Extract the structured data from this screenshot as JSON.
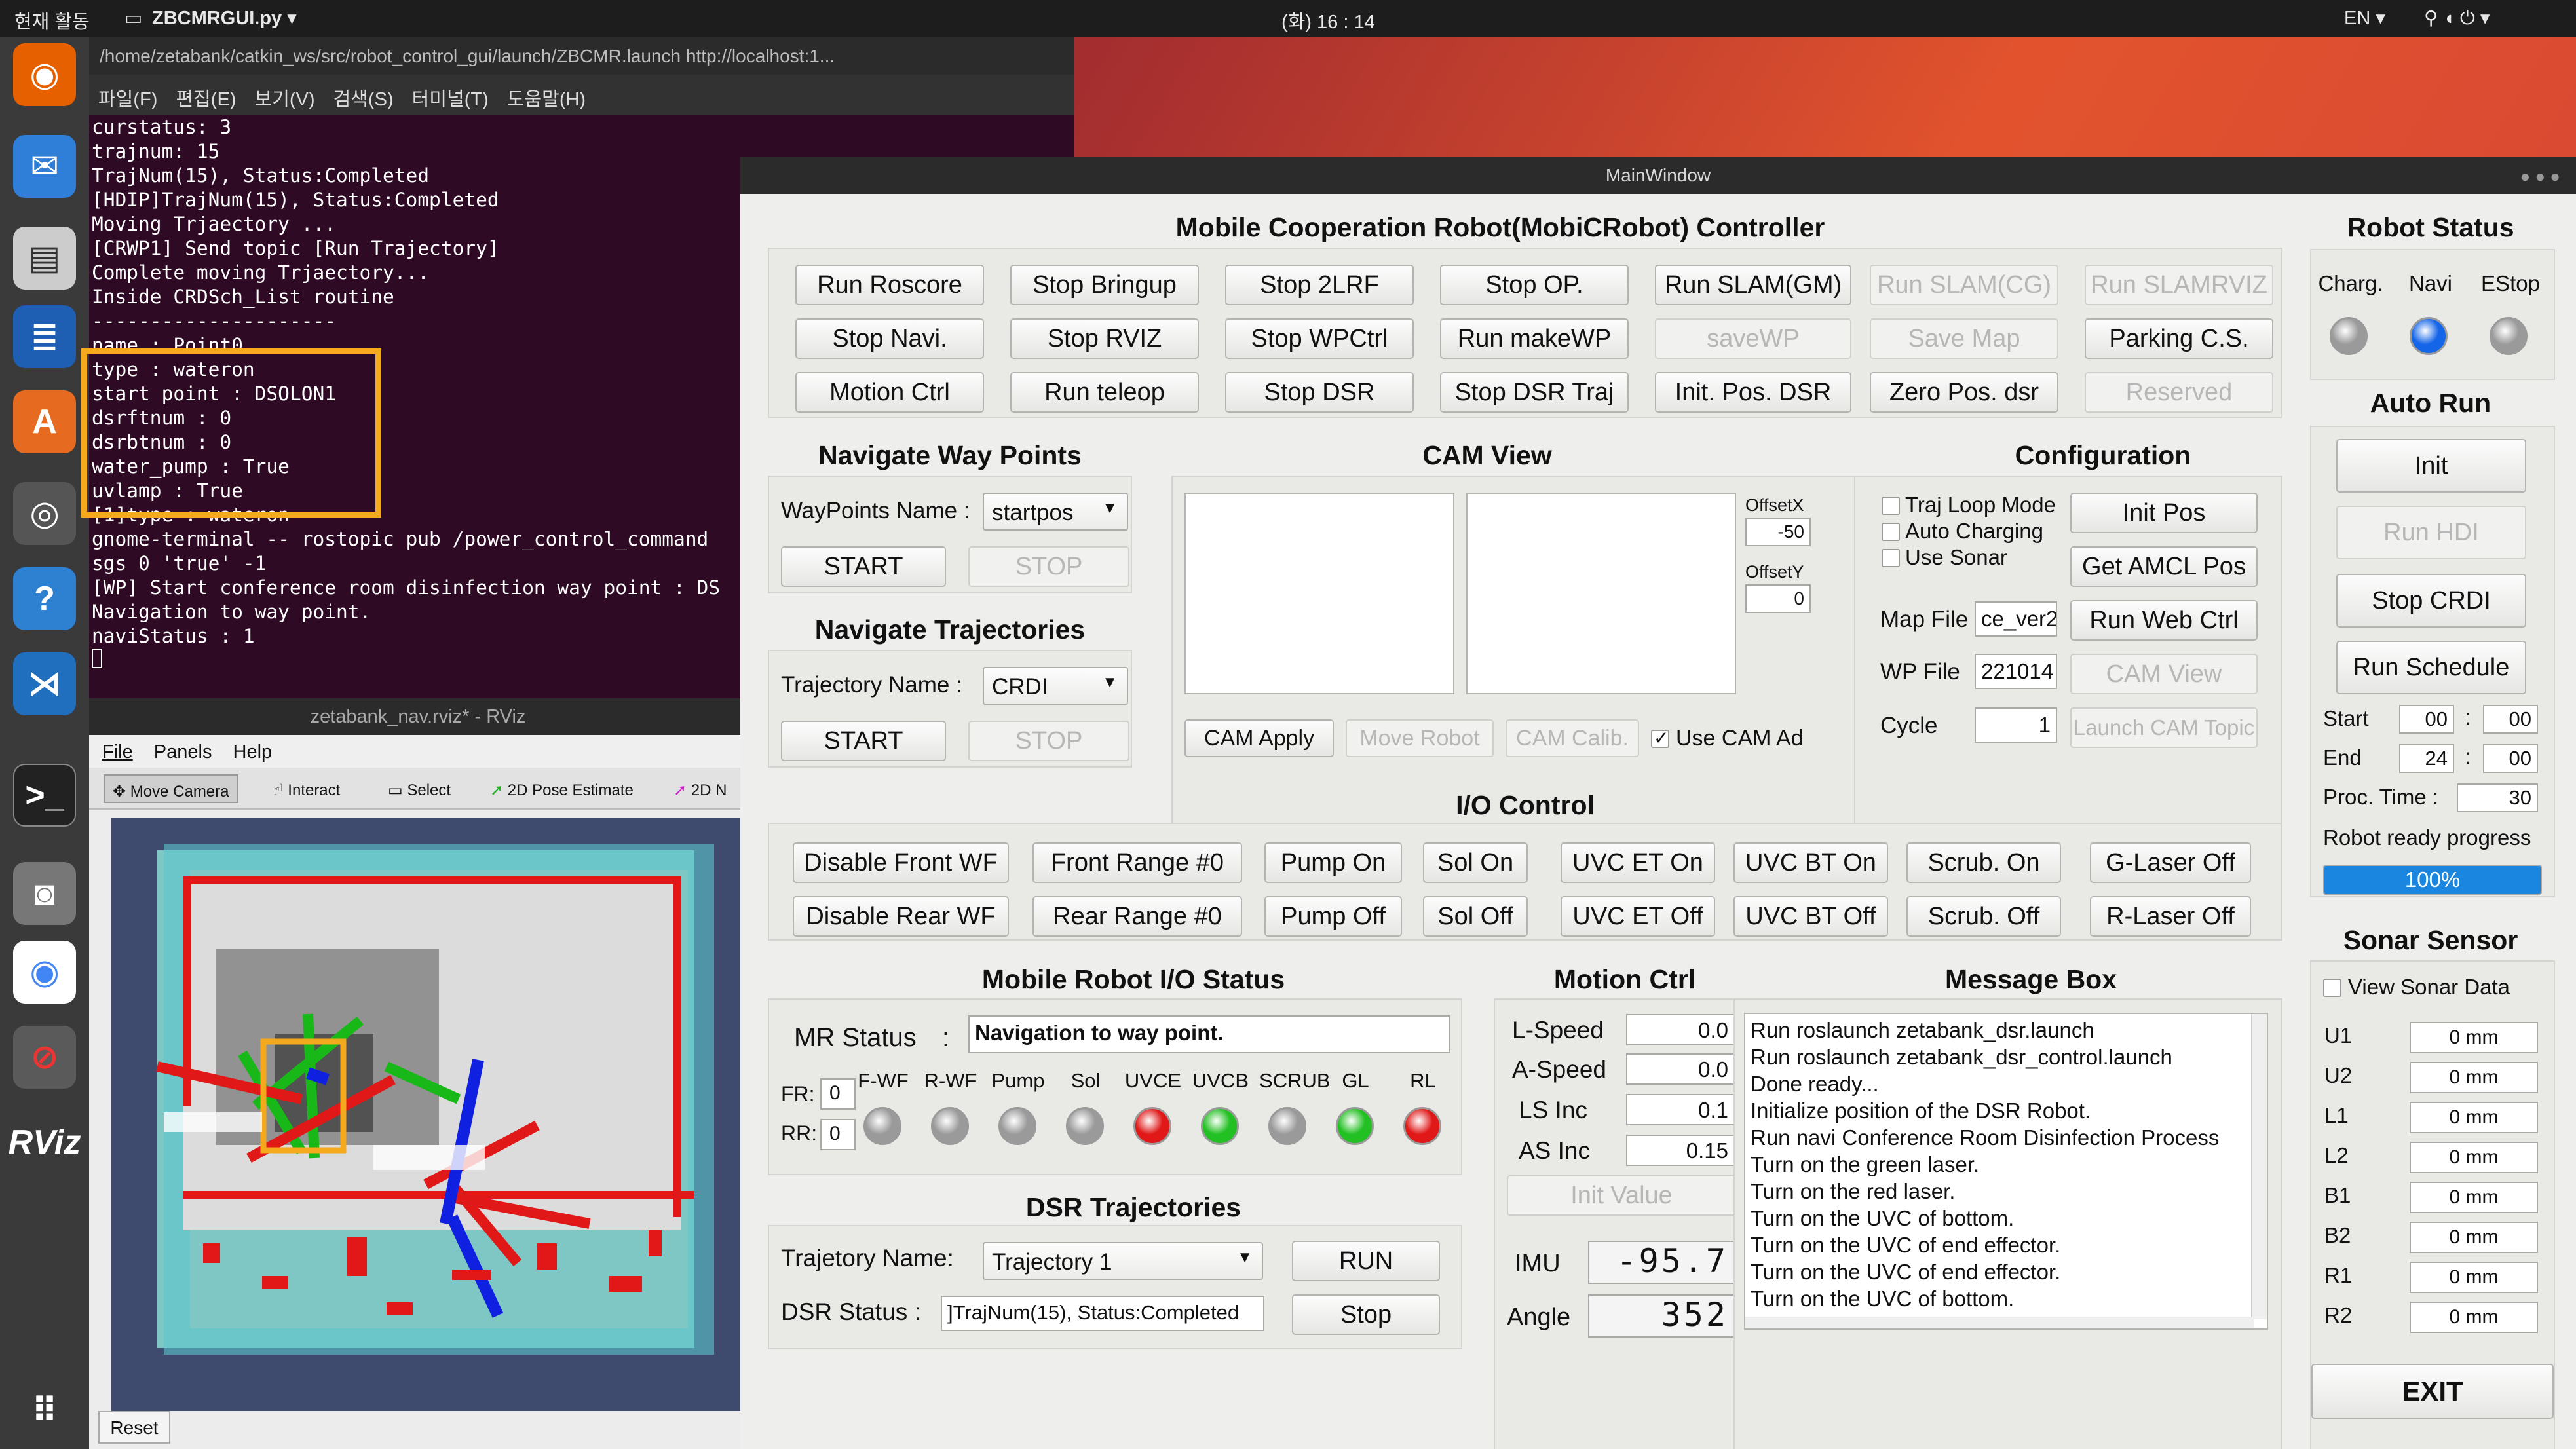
{
  "topbar": {
    "activities": "현재 활동",
    "app_name": "ZBCMRGUI.py ▾",
    "clock": "(화) 16 : 14",
    "lang": "EN ▾",
    "status_icons": "⚲ ◖ ⏻ ▾"
  },
  "terminal": {
    "title": "/home/zetabank/catkin_ws/src/robot_control_gui/launch/ZBCMR.launch http://localhost:1...",
    "menu": "파일(F) 편집(E) 보기(V) 검색(S) 터미널(T) 도움말(H)",
    "lines": [
      "curstatus: 3",
      "trajnum: 15",
      "TrajNum(15), Status:Completed",
      "[HDIP]TrajNum(15), Status:Completed",
      "Moving Trjaectory ...",
      "[CRWP1] Send topic [Run Trajectory]",
      "Complete moving Trjaectory...",
      "Inside CRDSch_List routine",
      "---------------------",
      "name : Point0",
      "type : wateron",
      "start point : DSOLON1",
      "dsrftnum : 0",
      "dsrbtnum : 0",
      "water_pump : True",
      "uvlamp : True",
      "",
      "[1]type : wateron",
      "gnome-terminal -- rostopic pub /power_control_command",
      "sgs 0 'true' -1",
      "[WP] Start conference room disinfection way point : DS",
      "Navigation to way point.",
      "naviStatus : 1"
    ]
  },
  "rviz": {
    "title": "zetabank_nav.rviz* - RViz",
    "menu": [
      "File",
      "Panels",
      "Help"
    ],
    "tools": [
      "Move Camera",
      "Interact",
      "Select",
      "2D Pose Estimate",
      "2D N"
    ],
    "reset": "Reset"
  },
  "main": {
    "window_title": "MainWindow",
    "controller_title": "Mobile Cooperation Robot(MobiCRobot) Controller",
    "top_buttons": [
      [
        "Run Roscore",
        "Stop Bringup",
        "Stop 2LRF",
        "Stop OP.",
        "Run SLAM(GM)",
        "Run SLAM(CG)",
        "Run SLAMRVIZ"
      ],
      [
        "Stop Navi.",
        "Stop RVIZ",
        "Stop WPCtrl",
        "Run makeWP",
        "saveWP",
        "Save Map",
        "Parking C.S."
      ],
      [
        "Motion Ctrl",
        "Run teleop",
        "Stop DSR",
        "Stop DSR Traj",
        "Init. Pos. DSR",
        "Zero Pos. dsr",
        "Reserved"
      ]
    ],
    "nav_wp": {
      "title": "Navigate Way Points",
      "name_label": "WayPoints Name :",
      "name_value": "startpos",
      "start": "START",
      "stop": "STOP"
    },
    "nav_traj": {
      "title": "Navigate Trajectories",
      "name_label": "Trajectory Name :",
      "name_value": "CRDI",
      "start": "START",
      "stop": "STOP"
    },
    "cam": {
      "title": "CAM View",
      "offsetx_label": "OffsetX",
      "offsetx": "-50",
      "offsety_label": "OffsetY",
      "offsety": "0",
      "apply": "CAM Apply",
      "move_robot": "Move Robot",
      "calib": "CAM Calib.",
      "use_ad": "Use CAM Ad"
    },
    "config": {
      "title": "Configuration",
      "traj_loop": "Traj Loop Mode",
      "auto_charging": "Auto Charging",
      "use_sonar": "Use Sonar",
      "init_pos": "Init Pos",
      "get_amcl": "Get AMCL Pos",
      "run_web": "Run Web Ctrl",
      "cam_view": "CAM View",
      "launch_cam": "Launch CAM Topic",
      "map_file_label": "Map File",
      "map_file": "ce_ver2",
      "wp_file_label": "WP File",
      "wp_file": "221014",
      "cycle_label": "Cycle",
      "cycle": "1"
    },
    "io": {
      "title": "I/O Control",
      "row1": [
        "Disable Front WF",
        "Front Range #0",
        "Pump On",
        "Sol On",
        "UVC ET On",
        "UVC BT On",
        "Scrub. On",
        "G-Laser Off"
      ],
      "row2": [
        "Disable Rear WF",
        "Rear Range #0",
        "Pump Off",
        "Sol Off",
        "UVC ET Off",
        "UVC BT Off",
        "Scrub. Off",
        "R-Laser Off"
      ]
    },
    "io_status": {
      "title": "Mobile Robot I/O Status",
      "mr_label": "MR Status",
      "mr_colon": ":",
      "mr_value": "Navigation to way point.",
      "fr_label": "FR:",
      "fr_value": "0",
      "rr_label": "RR:",
      "rr_value": "0",
      "leds": [
        {
          "label": "F-WF",
          "color": "#9a9a9a"
        },
        {
          "label": "R-WF",
          "color": "#9a9a9a"
        },
        {
          "label": "Pump",
          "color": "#9a9a9a"
        },
        {
          "label": "Sol",
          "color": "#9a9a9a"
        },
        {
          "label": "UVCE",
          "color": "#e01818"
        },
        {
          "label": "UVCB",
          "color": "#22c022"
        },
        {
          "label": "SCRUB",
          "color": "#9a9a9a"
        },
        {
          "label": "GL",
          "color": "#22c022"
        },
        {
          "label": "RL",
          "color": "#e01818"
        }
      ]
    },
    "dsr": {
      "title": "DSR Trajectories",
      "name_label": "Trajetory Name:",
      "name_value": "Trajectory 1",
      "run": "RUN",
      "status_label": "DSR Status :",
      "status_value": "]TrajNum(15), Status:Completed",
      "stop": "Stop"
    },
    "motion": {
      "title": "Motion Ctrl",
      "lspeed_label": "L-Speed",
      "lspeed": "0.0",
      "aspeed_label": "A-Speed",
      "aspeed": "0.0",
      "lsinc_label": "LS Inc",
      "lsinc": "0.1",
      "asinc_label": "AS Inc",
      "asinc": "0.15",
      "init_value": "Init Value",
      "imu_label": "IMU",
      "imu": "-95.7",
      "angle_label": "Angle",
      "angle": "352"
    },
    "msgbox": {
      "title": "Message Box",
      "lines": [
        "Run roslaunch zetabank_dsr.launch",
        "Run roslaunch zetabank_dsr_control.launch",
        "Done ready...",
        "Initialize position of the DSR Robot.",
        "Run navi Conference Room Disinfection Process",
        "Turn on the green laser.",
        "Turn on the red laser.",
        "Turn on the UVC of bottom.",
        "Turn on the UVC of end effector.",
        "Turn on the UVC of end effector.",
        "Turn on the UVC of bottom."
      ]
    },
    "robot_status": {
      "title": "Robot Status",
      "leds": [
        {
          "label": "Charg.",
          "color": "#9a9a9a"
        },
        {
          "label": "Navi",
          "color": "#1565e8"
        },
        {
          "label": "EStop",
          "color": "#9a9a9a"
        }
      ]
    },
    "auto_run": {
      "title": "Auto Run",
      "init": "Init",
      "run_hdi": "Run HDI",
      "stop_crdi": "Stop CRDI",
      "run_schedule": "Run Schedule",
      "start_label": "Start",
      "start_h": "00",
      "start_m": "00",
      "end_label": "End",
      "end_h": "24",
      "end_m": "00",
      "colon": ":",
      "proc_label": "Proc. Time :",
      "proc": "30",
      "ready_label": "Robot ready progress",
      "progress_text": "100%",
      "progress": 1.0
    },
    "sonar": {
      "title": "Sonar Sensor",
      "view": "View Sonar Data",
      "rows": [
        {
          "label": "U1",
          "value": "0 mm"
        },
        {
          "label": "U2",
          "value": "0 mm"
        },
        {
          "label": "L1",
          "value": "0 mm"
        },
        {
          "label": "L2",
          "value": "0 mm"
        },
        {
          "label": "B1",
          "value": "0 mm"
        },
        {
          "label": "B2",
          "value": "0 mm"
        },
        {
          "label": "R1",
          "value": "0 mm"
        },
        {
          "label": "R2",
          "value": "0 mm"
        }
      ]
    },
    "exit": "EXIT"
  }
}
